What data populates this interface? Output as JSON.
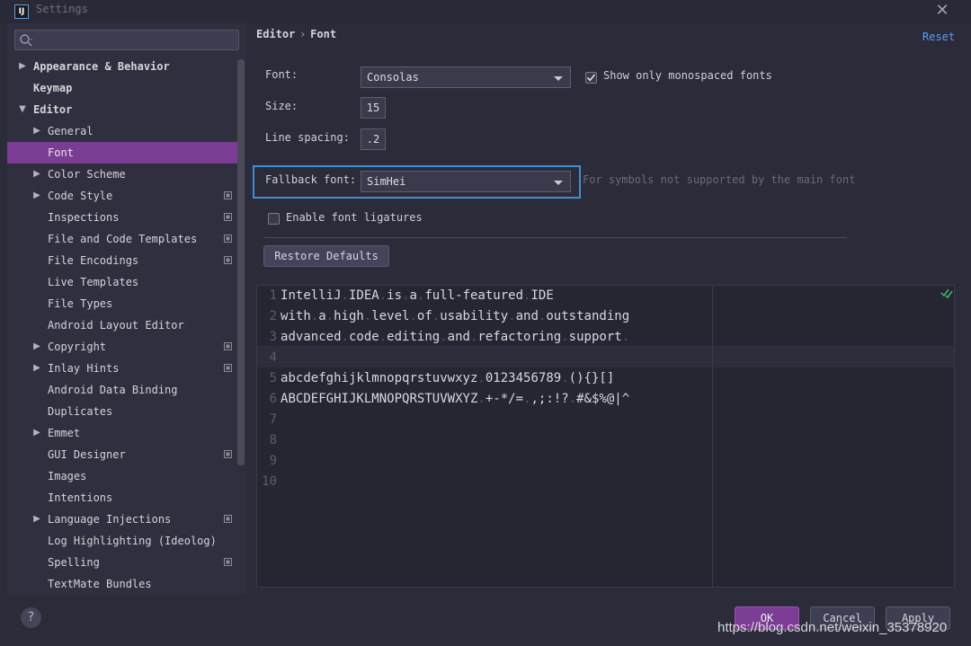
{
  "window": {
    "title": "Settings"
  },
  "search": {
    "placeholder": ""
  },
  "sidebar": {
    "items": [
      {
        "label": "Appearance & Behavior",
        "arrow": "▶",
        "bold": true
      },
      {
        "label": "Keymap",
        "arrow": "",
        "bold": true
      },
      {
        "label": "Editor",
        "arrow": "▼",
        "bold": true
      },
      {
        "label": "General",
        "arrow": "▶"
      },
      {
        "label": "Font",
        "arrow": "",
        "selected": true
      },
      {
        "label": "Color Scheme",
        "arrow": "▶"
      },
      {
        "label": "Code Style",
        "arrow": "▶",
        "project": true
      },
      {
        "label": "Inspections",
        "arrow": "",
        "project": true
      },
      {
        "label": "File and Code Templates",
        "arrow": "",
        "project": true
      },
      {
        "label": "File Encodings",
        "arrow": "",
        "project": true
      },
      {
        "label": "Live Templates",
        "arrow": ""
      },
      {
        "label": "File Types",
        "arrow": ""
      },
      {
        "label": "Android Layout Editor",
        "arrow": ""
      },
      {
        "label": "Copyright",
        "arrow": "▶",
        "project": true
      },
      {
        "label": "Inlay Hints",
        "arrow": "▶",
        "project": true
      },
      {
        "label": "Android Data Binding",
        "arrow": ""
      },
      {
        "label": "Duplicates",
        "arrow": ""
      },
      {
        "label": "Emmet",
        "arrow": "▶"
      },
      {
        "label": "GUI Designer",
        "arrow": "",
        "project": true
      },
      {
        "label": "Images",
        "arrow": ""
      },
      {
        "label": "Intentions",
        "arrow": ""
      },
      {
        "label": "Language Injections",
        "arrow": "▶",
        "project": true
      },
      {
        "label": "Log Highlighting (Ideolog)",
        "arrow": ""
      },
      {
        "label": "Spelling",
        "arrow": "",
        "project": true
      },
      {
        "label": "TextMate Bundles",
        "arrow": ""
      }
    ]
  },
  "breadcrumb": {
    "parent": "Editor",
    "separator": "›",
    "current": "Font"
  },
  "reset_label": "Reset",
  "form": {
    "font_label": "Font:",
    "font_value": "Consolas",
    "mono_label": "Show only monospaced fonts",
    "mono_checked": true,
    "size_label": "Size:",
    "size_value": "15",
    "spacing_label": "Line spacing:",
    "spacing_value": ".2",
    "fallback_label": "Fallback font:",
    "fallback_value": "SimHei",
    "fallback_hint": "For symbols not supported by the main font",
    "ligatures_label": "Enable font ligatures",
    "ligatures_checked": false,
    "restore_label": "Restore Defaults"
  },
  "preview": {
    "lines": [
      {
        "n": "1",
        "text": "IntelliJ.IDEA.is.a.full-featured.IDE"
      },
      {
        "n": "2",
        "text": "with.a.high.level.of.usability.and.outstanding"
      },
      {
        "n": "3",
        "text": "advanced.code.editing.and.refactoring.support."
      },
      {
        "n": "4",
        "text": ""
      },
      {
        "n": "5",
        "text": "abcdefghijklmnopqrstuvwxyz.0123456789.(){}[]"
      },
      {
        "n": "6",
        "text": "ABCDEFGHIJKLMNOPQRSTUVWXYZ.+-*/=.,;:!?.#&$%@|^"
      },
      {
        "n": "7",
        "text": ""
      },
      {
        "n": "8",
        "text": ""
      },
      {
        "n": "9",
        "text": ""
      },
      {
        "n": "10",
        "text": ""
      }
    ]
  },
  "buttons": {
    "ok": "OK",
    "cancel": "Cancel",
    "apply": "Apply",
    "help": "?"
  },
  "watermark": "https://blog.csdn.net/weixin_35378920",
  "colors": {
    "accent": "#7b3c93",
    "highlight_frame": "#3e8fd6",
    "link": "#589df6"
  }
}
